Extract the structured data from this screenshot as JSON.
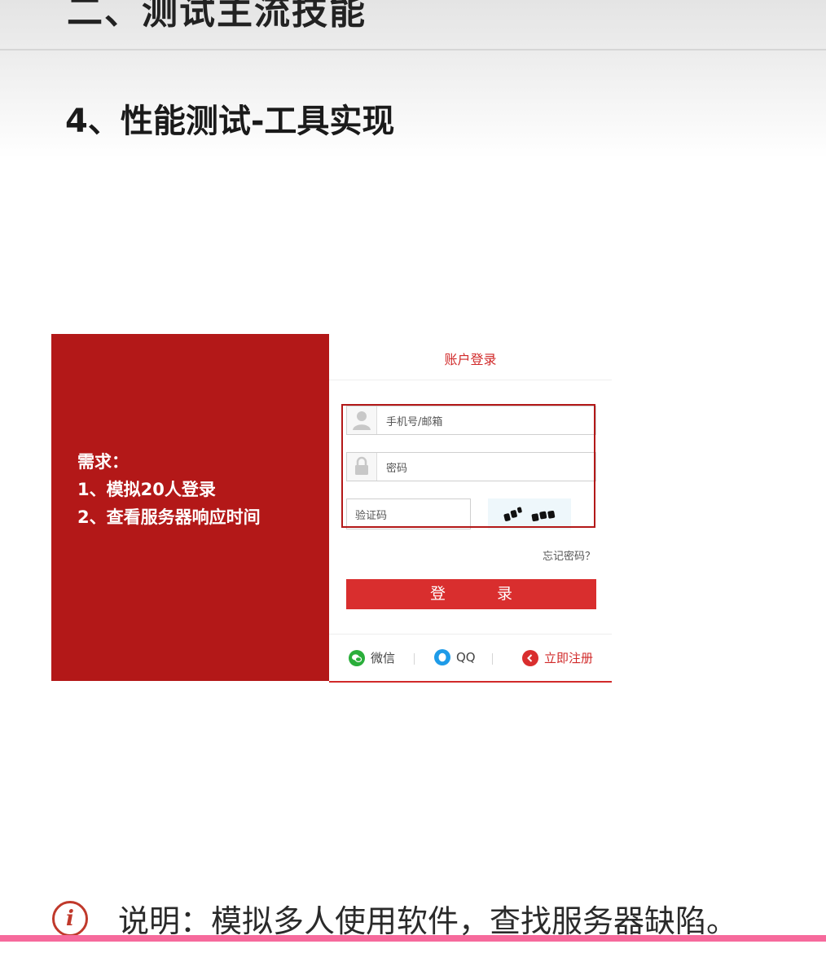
{
  "header": {
    "section_title": "二、测试主流技能",
    "slide_subtitle": "4、性能测试-工具实现"
  },
  "requirements": {
    "heading": "需求：",
    "items": [
      "1、模拟20人登录",
      "2、查看服务器响应时间"
    ]
  },
  "login_form": {
    "title": "账户登录",
    "username_placeholder": "手机号/邮箱",
    "password_placeholder": "密码",
    "captcha_placeholder": "验证码",
    "forgot_password": "忘记密码？",
    "login_button": "登　录",
    "social": {
      "wechat": "微信",
      "qq": "QQ",
      "register": "立即注册"
    },
    "colors": {
      "accent": "#d92e2e",
      "panel": "#b31818",
      "wechat": "#2aae3a",
      "qq": "#1e9be8"
    }
  },
  "footer": {
    "note_label": "说明：",
    "note_text": "模拟多人使用软件，查找服务器缺陷。"
  },
  "icons": [
    "user-icon",
    "lock-icon",
    "captcha-image",
    "wechat-icon",
    "qq-icon",
    "register-arrow-icon",
    "info-icon"
  ]
}
